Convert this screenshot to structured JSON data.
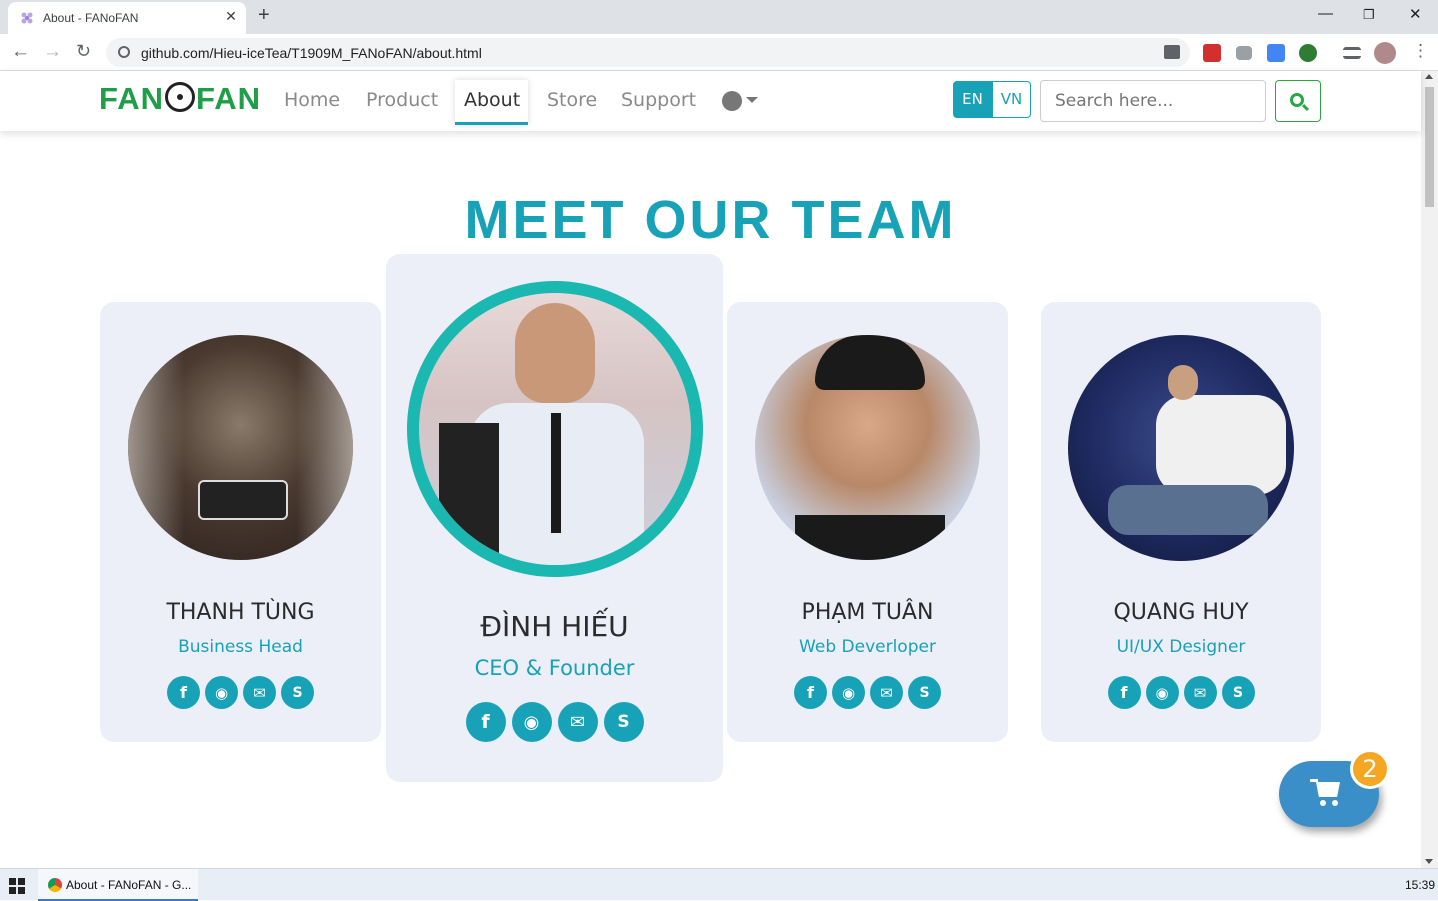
{
  "browser": {
    "tab_title": "About - FANoFAN",
    "url": "github.com/Hieu-iceTea/T1909M_FANoFAN/about.html"
  },
  "site": {
    "logo_left": "FAN",
    "logo_right": "FAN",
    "nav": [
      {
        "label": "Home"
      },
      {
        "label": "Product"
      },
      {
        "label": "About"
      },
      {
        "label": "Store"
      },
      {
        "label": "Support"
      }
    ],
    "lang_en": "EN",
    "lang_vn": "VN",
    "search_placeholder": "Search here...",
    "heading": "MEET OUR TEAM",
    "team": [
      {
        "name": "THANH TÙNG",
        "role": "Business Head"
      },
      {
        "name": "ĐÌNH HIẾU",
        "role": "CEO & Founder"
      },
      {
        "name": "PHẠM TUÂN",
        "role": "Web Deverloper"
      },
      {
        "name": "QUANG HUY",
        "role": "UI/UX Designer"
      }
    ],
    "social_glyphs": {
      "facebook": "f",
      "github": "◉",
      "email": "✉",
      "skype": "S"
    },
    "cart_count": "2"
  },
  "taskbar": {
    "item_label": "About - FANoFAN - G...",
    "clock": "15:39"
  },
  "colors": {
    "accent": "#17a2b8",
    "brand_green": "#1e9e47",
    "card_bg": "#eceef8",
    "cart": "#3a8fc8",
    "badge": "#f5a623"
  }
}
